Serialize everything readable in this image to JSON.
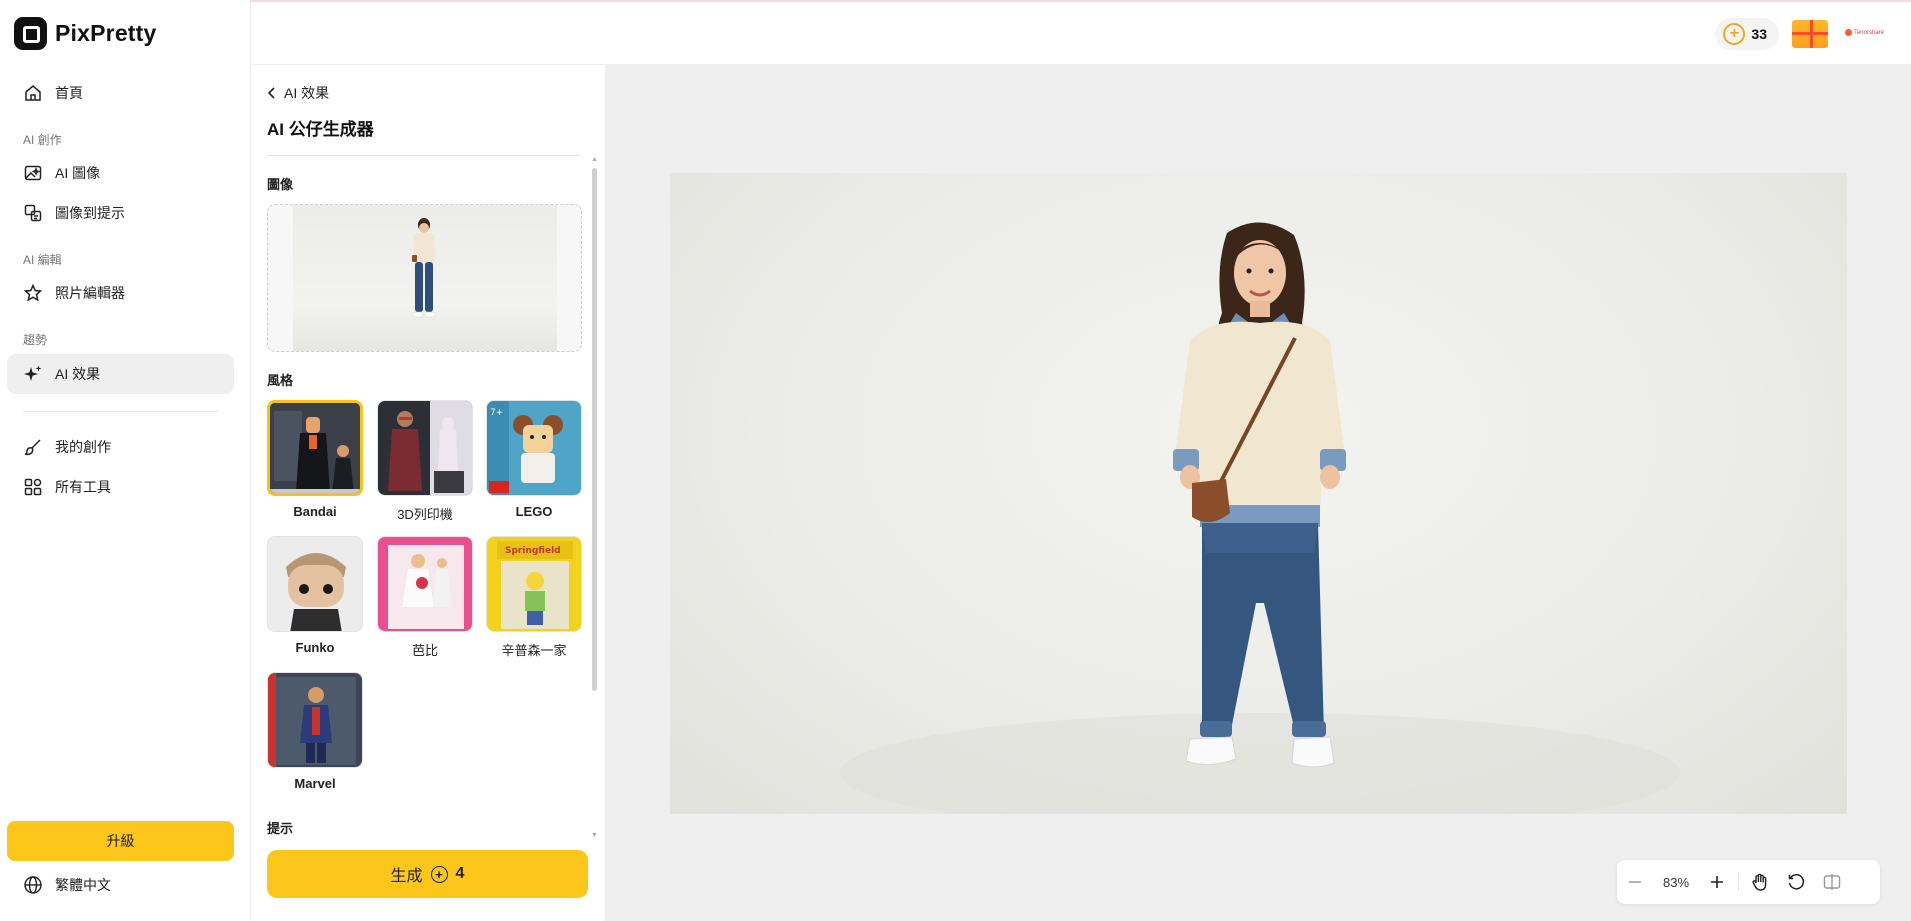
{
  "app": {
    "name": "PixPretty"
  },
  "sidebar": {
    "home": "首頁",
    "sections": {
      "ai_create": "AI 創作",
      "ai_edit": "AI 編輯",
      "trends": "趨勢"
    },
    "items": {
      "ai_image": "AI 圖像",
      "image_to_prompt": "圖像到提示",
      "photo_editor": "照片編輯器",
      "ai_effects": "AI 效果",
      "my_creations": "我的創作",
      "all_tools": "所有工具"
    },
    "upgrade": "升級",
    "language": "繁體中文"
  },
  "topbar": {
    "credits": "33",
    "brand_small": "Tenorshare"
  },
  "panel": {
    "back_label": "AI 效果",
    "title": "AI 公仔生成器",
    "image_label": "圖像",
    "style_label": "風格",
    "prompt_label": "提示",
    "styles": [
      {
        "name": "Bandai",
        "selected": true
      },
      {
        "name": "3D列印機",
        "selected": false
      },
      {
        "name": "LEGO",
        "selected": false
      },
      {
        "name": "Funko",
        "selected": false
      },
      {
        "name": "芭比",
        "selected": false
      },
      {
        "name": "辛普森一家",
        "selected": false
      },
      {
        "name": "Marvel",
        "selected": false
      }
    ],
    "generate_label": "生成",
    "generate_cost": "4"
  },
  "canvas": {
    "zoom": "83%"
  },
  "colors": {
    "accent": "#fcc61b",
    "selected_border": "#f6c21a",
    "canvas_bg": "#efefef"
  }
}
